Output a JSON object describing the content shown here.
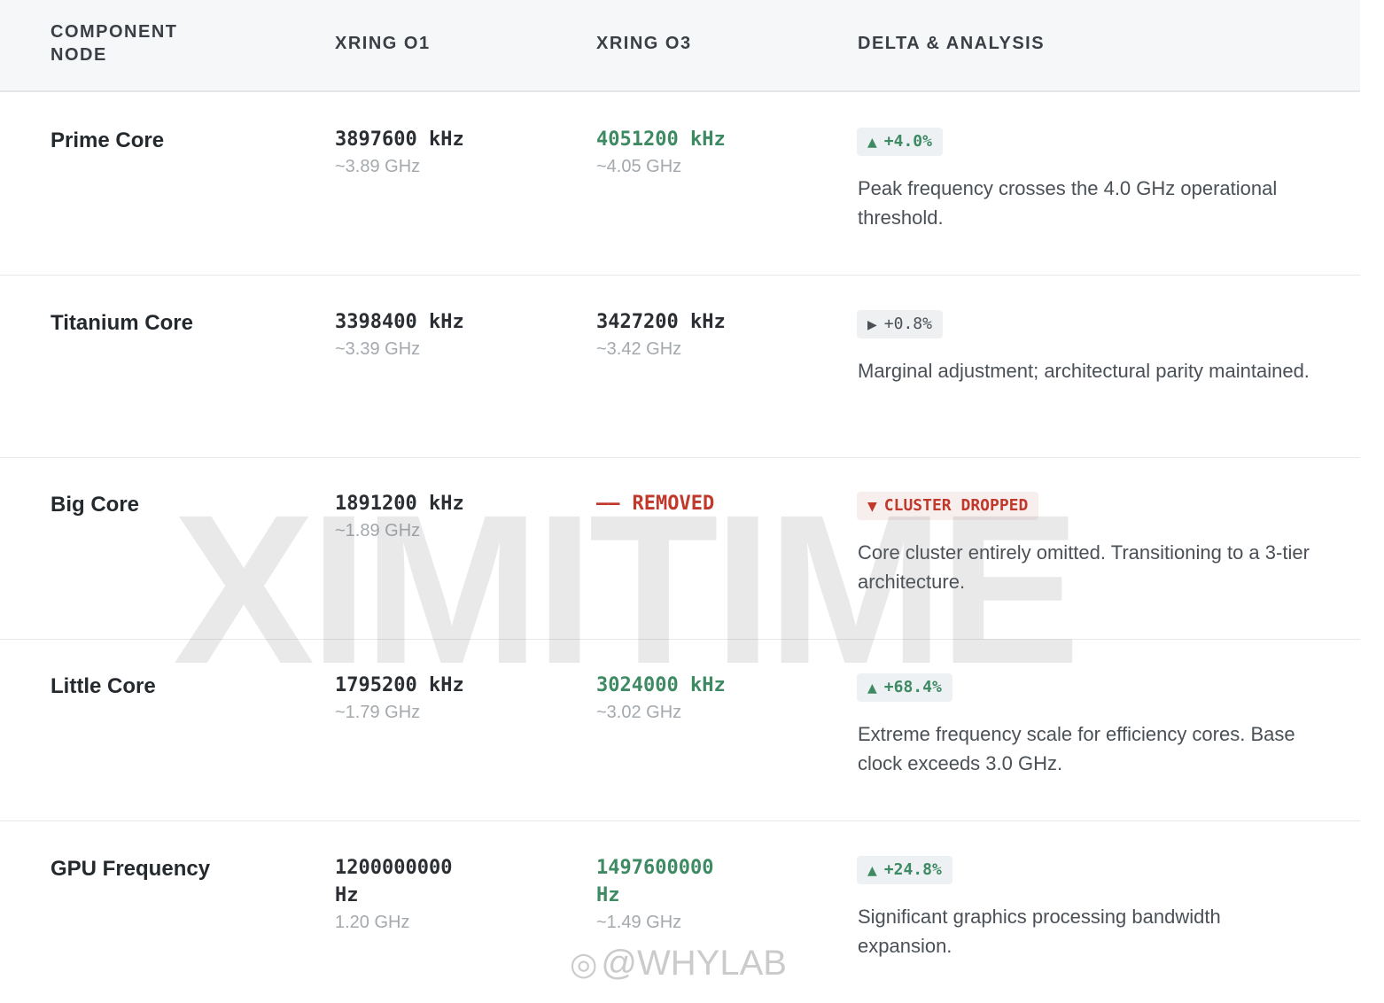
{
  "header": {
    "component": "COMPONENT NODE",
    "o1": "XRING O1",
    "o3": "XRING O3",
    "delta": "DELTA & ANALYSIS"
  },
  "rows": [
    {
      "name": "Prime Core",
      "o1_value": "3897600 kHz",
      "o1_sub": "~3.89 GHz",
      "o3_value": "4051200 kHz",
      "o3_sub": "~4.05 GHz",
      "badge_arrow": "▲",
      "badge_text": "+4.0%",
      "note": "Peak frequency crosses the 4.0 GHz operational threshold."
    },
    {
      "name": "Titanium Core",
      "o1_value": "3398400 kHz",
      "o1_sub": "~3.39 GHz",
      "o3_value": "3427200 kHz",
      "o3_sub": "~3.42 GHz",
      "badge_arrow": "▶",
      "badge_text": "+0.8%",
      "note": "Marginal adjustment; architectural parity maintained."
    },
    {
      "name": "Big Core",
      "o1_value": "1891200 kHz",
      "o1_sub": "~1.89 GHz",
      "o3_value": "REMOVED",
      "o3_dash": "——",
      "badge_arrow": "▼",
      "badge_text": "CLUSTER DROPPED",
      "note": "Core cluster entirely omitted. Transitioning to a 3-tier architecture."
    },
    {
      "name": "Little Core",
      "o1_value": "1795200 kHz",
      "o1_sub": "~1.79 GHz",
      "o3_value": "3024000 kHz",
      "o3_sub": "~3.02 GHz",
      "badge_arrow": "▲",
      "badge_text": "+68.4%",
      "note": "Extreme frequency scale for efficiency cores. Base clock exceeds 3.0 GHz."
    },
    {
      "name": "GPU Frequency",
      "o1_value": "1200000000 Hz",
      "o1_sub": "1.20 GHz",
      "o3_value": "1497600000 Hz",
      "o3_sub": "~1.49 GHz",
      "badge_arrow": "▲",
      "badge_text": "+24.8%",
      "note": "Significant graphics processing bandwidth expansion."
    }
  ],
  "overlay": {
    "watermark": "XIMITIME",
    "credit_logo": "◎",
    "credit": "@WHYLAB"
  },
  "colors": {
    "increase": "#3d8a63",
    "removed": "#c0392b",
    "neutral": "#4a5056"
  }
}
